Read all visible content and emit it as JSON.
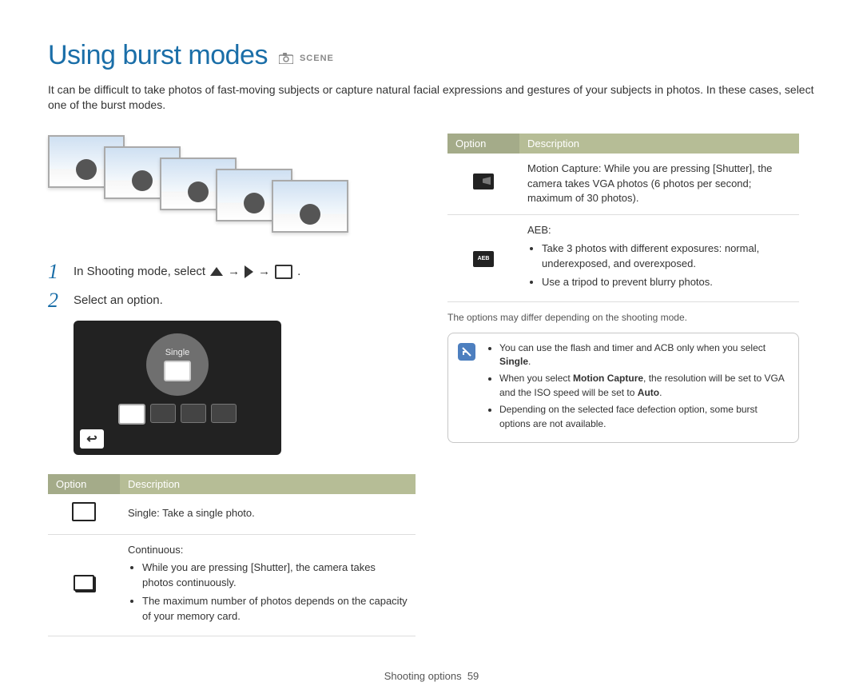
{
  "title": "Using burst modes",
  "mode_icons": [
    "p",
    "SCENE"
  ],
  "intro": "It can be difficult to take photos of fast-moving subjects or capture natural facial expressions and gestures of your subjects in photos. In these cases, select one of the burst modes.",
  "steps": {
    "one": {
      "num": "1",
      "prefix": "In Shooting mode, select",
      "arrow": "→"
    },
    "two": {
      "num": "2",
      "text": "Select an option."
    }
  },
  "lcd": {
    "selected_label": "Single",
    "back_glyph": "↩"
  },
  "table_headers": {
    "option": "Option",
    "description": "Description"
  },
  "left_rows": [
    {
      "icon": "single",
      "html": "<b>Single</b>: Take a single photo."
    },
    {
      "icon": "stack",
      "html": "<b>Continuous</b>:",
      "bullets": [
        "While you are pressing [<b>Shutter</b>], the camera takes photos continuously.",
        "The maximum number of photos depends on the capacity of your memory card."
      ]
    }
  ],
  "right_rows": [
    {
      "icon": "run",
      "html": "<b>Motion Capture</b>: While you are pressing [<b>Shutter</b>], the camera takes VGA photos (6 photos per second; maximum of 30 photos)."
    },
    {
      "icon": "aeb",
      "html": "<b>AEB</b>:",
      "bullets": [
        "Take 3 photos with different exposures: normal, underexposed, and overexposed.",
        "Use a tripod to prevent blurry photos."
      ]
    }
  ],
  "footnote": "The options may differ depending on the shooting mode.",
  "tips": [
    "You can use the flash and timer and ACB only when you select <b>Single</b>.",
    "When you select <b>Motion Capture</b>, the resolution will be set to VGA and the ISO speed will be set to <b>Auto</b>.",
    "Depending on the selected face defection option, some burst options are not available."
  ],
  "footer": {
    "section": "Shooting options",
    "page": "59"
  }
}
